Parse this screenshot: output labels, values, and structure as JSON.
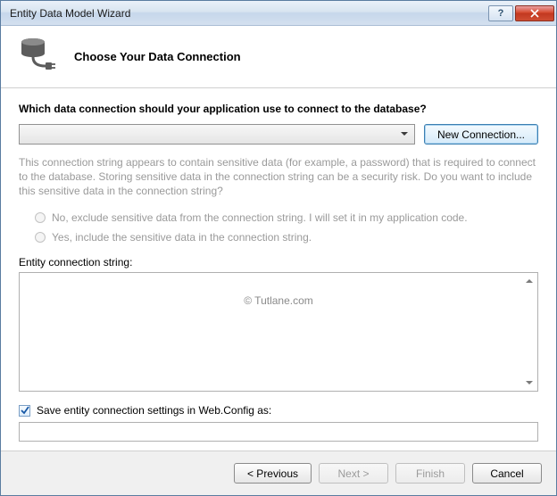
{
  "window": {
    "title": "Entity Data Model Wizard"
  },
  "header": {
    "title": "Choose Your Data Connection"
  },
  "content": {
    "prompt": "Which data connection should your application use to connect to the database?",
    "combo_value": "",
    "new_connection_label": "New Connection...",
    "info_text": "This connection string appears to contain sensitive data (for example, a password) that is required to connect to the database. Storing sensitive data in the connection string can be a security risk. Do you want to include this sensitive data in the connection string?",
    "radio_exclude": "No, exclude sensitive data from the connection string. I will set it in my application code.",
    "radio_include": "Yes, include the sensitive data in the connection string.",
    "entity_label": "Entity connection string:",
    "textarea_value": "",
    "watermark": "© Tutlane.com",
    "save_check_label": "Save entity connection settings in Web.Config as:",
    "save_name_value": ""
  },
  "footer": {
    "previous": "< Previous",
    "next": "Next >",
    "finish": "Finish",
    "cancel": "Cancel"
  }
}
